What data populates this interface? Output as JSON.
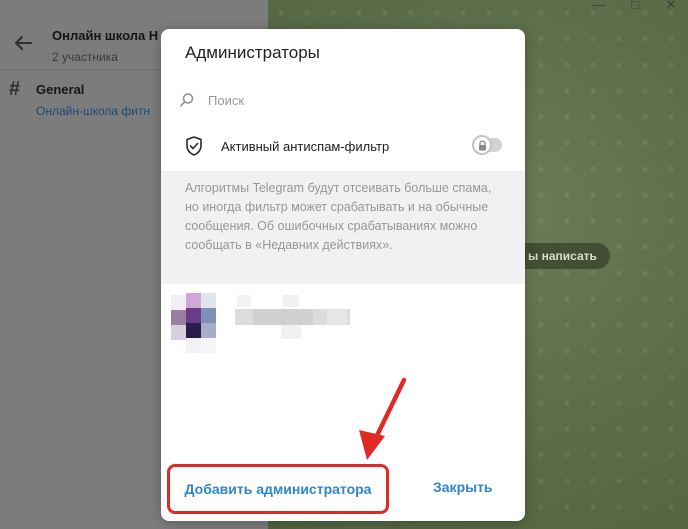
{
  "background": {
    "chat_title": "Онлайн школа Н",
    "chat_subtitle": "2 участника",
    "topic_title": "General",
    "topic_subtitle": "Онлайн-школа фитн",
    "write_hint": "ы написать",
    "window_controls": [
      "—",
      "□",
      "✕"
    ]
  },
  "dialog": {
    "title": "Администраторы",
    "search_placeholder": "Поиск",
    "antispam_label": "Активный антиспам-фильтр",
    "antispam_enabled": false,
    "info_text": "Алгоритмы Telegram будут отсеивать больше спама, но иногда фильтр может срабатывать и на обычные сообщения. Об ошибочных срабатываниях можно сообщать в «Недавних действиях».",
    "add_admin_label": "Добавить администратора",
    "close_label": "Закрыть"
  },
  "colors": {
    "accent": "#2f86c9",
    "highlight": "#e02a26"
  }
}
